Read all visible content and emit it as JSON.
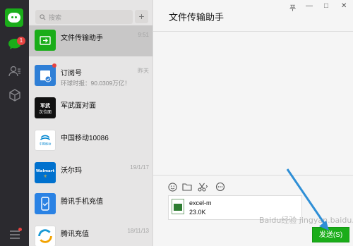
{
  "colors": {
    "accent": "#1aad19",
    "badge": "#e64340",
    "rail": "#2b2a2f",
    "list_bg": "#e6e5e5",
    "arrow": "#2f8fd6"
  },
  "rail": {
    "chat_badge": "1",
    "icons": [
      "avatar",
      "chat-icon",
      "contacts-icon",
      "cube-icon",
      "menu-icon"
    ]
  },
  "search": {
    "placeholder": "搜索",
    "add_label": "+"
  },
  "conversations": [
    {
      "title": "文件传输助手",
      "subtitle": "",
      "time": "9:51",
      "icon": "file-transfer-icon",
      "color": "#1aad19",
      "active": true
    },
    {
      "title": "订阅号",
      "subtitle": "环球时报：90.0309万亿！",
      "time": "昨天",
      "icon": "subscription-icon",
      "color": "#2f7fd6"
    },
    {
      "title": "军武面对面",
      "subtitle": "",
      "time": "",
      "icon": "military-logo",
      "color": "#111111"
    },
    {
      "title": "中国移动10086",
      "subtitle": "",
      "time": "",
      "icon": "china-mobile-logo",
      "color": "#ffffff"
    },
    {
      "title": "沃尔玛",
      "subtitle": "",
      "time": "19/1/17",
      "icon": "walmart-logo",
      "color": "#0071ce"
    },
    {
      "title": "腾讯手机充值",
      "subtitle": "",
      "time": "",
      "icon": "phone-recharge-icon",
      "color": "#2a82e4"
    },
    {
      "title": "腾讯充值",
      "subtitle": "",
      "time": "18/11/13",
      "icon": "recharge-icon",
      "color": "#1b9ad6"
    }
  ],
  "chat": {
    "title": "文件传输助手",
    "window_controls": [
      "푸",
      "—",
      "□",
      "✕"
    ],
    "toolbar": [
      "emoji-icon",
      "folder-icon",
      "scissors-icon",
      "chat-bubble-icon"
    ],
    "file": {
      "name": "excel-m",
      "size": "23.0K"
    },
    "send_label": "发送(S)",
    "watermark": "Baidu经验 jingyan.baidu.com"
  },
  "logo_texts": {
    "military": "军武次位面",
    "china_mobile": "中国移动 China Mobile",
    "walmart": "Walmart"
  }
}
